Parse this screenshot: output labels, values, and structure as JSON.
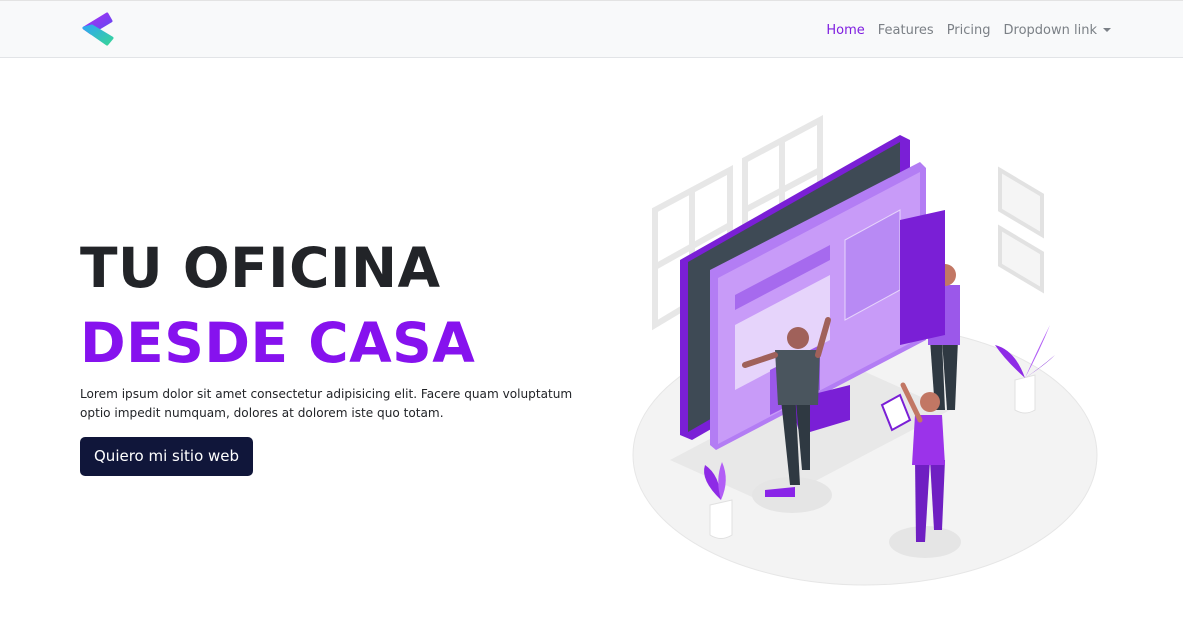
{
  "navbar": {
    "brand_icon": "brand-chevron-logo",
    "links": [
      {
        "label": "Home",
        "active": true
      },
      {
        "label": "Features",
        "active": false
      },
      {
        "label": "Pricing",
        "active": false
      },
      {
        "label": "Dropdown link",
        "active": false,
        "icon": "caret-down-icon"
      }
    ]
  },
  "hero": {
    "title_line1": "TU OFICINA",
    "title_line2": "DESDE CASA",
    "description": "Lorem ipsum dolor sit amet consectetur adipisicing elit. Facere quam voluptatum optio impedit numquam, dolores at dolorem iste quo totam.",
    "cta_label": "Quiero mi sitio web"
  },
  "colors": {
    "accent": "#8612ee",
    "nav_active": "#7f1ee0",
    "button_bg": "#10163a",
    "navbar_bg": "#f8f9fa"
  }
}
